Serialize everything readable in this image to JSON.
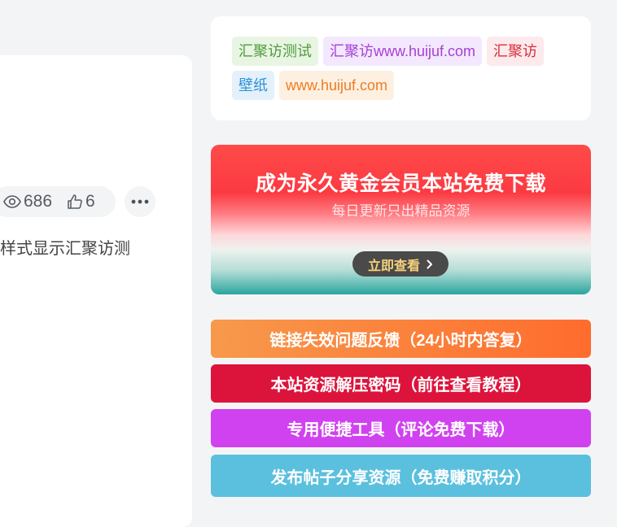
{
  "post": {
    "views": "686",
    "likes": "6",
    "excerpt": "样式显示汇聚访测"
  },
  "tags": [
    {
      "label": "汇聚访测试",
      "bg": "#e8f5e3",
      "color": "#4f9a3c"
    },
    {
      "label": "汇聚访www.huijuf.com",
      "bg": "#f3e8fd",
      "color": "#a73fd4"
    },
    {
      "label": "汇聚访",
      "bg": "#fdeaec",
      "color": "#d5303f"
    },
    {
      "label": "壁纸",
      "bg": "#e4f1fb",
      "color": "#2e92d8"
    },
    {
      "label": "www.huijuf.com",
      "bg": "#fdf0e1",
      "color": "#ef7d22"
    }
  ],
  "banner": {
    "title": "成为永久黄金会员本站免费下载",
    "subtitle": "每日更新只出精品资源",
    "button": "立即查看"
  },
  "links": [
    {
      "label": "链接失效问题反馈（24小时内答复）",
      "bg": "linear-gradient(90deg,#f7994b,#ff6c2d)"
    },
    {
      "label": "本站资源解压密码（前往查看教程）",
      "bg": "#dc143c"
    },
    {
      "label": "专用便捷工具（评论免费下载）",
      "bg": "#d042ef"
    },
    {
      "label": "发布帖子分享资源（免费赚取积分）",
      "bg": "#5bc0de"
    }
  ],
  "icons": {
    "views": "eye-icon",
    "likes": "thumbs-up-icon",
    "more": "more-dots-icon",
    "banner_arrow": "chevron-right-icon"
  }
}
